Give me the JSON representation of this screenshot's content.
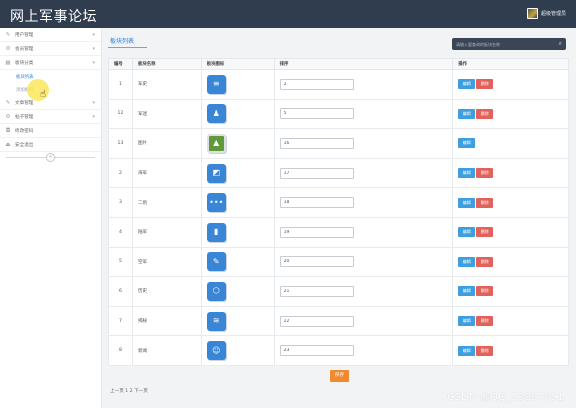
{
  "header": {
    "title": "网上军事论坛",
    "user_label": "超级管理员"
  },
  "sidebar": {
    "items": [
      {
        "label": "用户管理",
        "icon": "pencil-icon",
        "caret": "▾"
      },
      {
        "label": "会员管理",
        "icon": "gear-icon",
        "caret": "▾"
      },
      {
        "label": "板块分类",
        "icon": "calendar-icon",
        "caret": "▾",
        "children": [
          {
            "label": "板块列表"
          },
          {
            "label": "添加板块"
          }
        ]
      },
      {
        "label": "文章管理",
        "icon": "pencil-icon",
        "caret": "▾"
      },
      {
        "label": "帖子管理",
        "icon": "gear-icon",
        "caret": "▾"
      },
      {
        "label": "修改密码",
        "icon": "lock-icon"
      },
      {
        "label": "安全退出",
        "icon": "exit-icon"
      }
    ],
    "collapse_symbol": "«"
  },
  "main": {
    "tab_label": "板块列表",
    "search_placeholder": "请输入要查询的板块名称",
    "columns": [
      "编号",
      "板块名称",
      "板块图标",
      "排序",
      "操作"
    ],
    "rows": [
      {
        "id": "1",
        "name": "军史",
        "icon": "document-icon",
        "glyph": "≡",
        "order": "2"
      },
      {
        "id": "12",
        "name": "军迷",
        "icon": "qq-icon",
        "glyph": "♟",
        "order": "5"
      },
      {
        "id": "13",
        "name": "图片",
        "icon": "photo-icon",
        "glyph": "▲",
        "order": "16"
      },
      {
        "id": "2",
        "name": "海军",
        "icon": "image-icon",
        "glyph": "◩",
        "order": "17"
      },
      {
        "id": "3",
        "name": "二炮",
        "icon": "more-icon",
        "glyph": "•••",
        "order": "18"
      },
      {
        "id": "4",
        "name": "陆军",
        "icon": "info-icon",
        "glyph": "▮",
        "order": "19"
      },
      {
        "id": "5",
        "name": "空军",
        "icon": "edit-icon",
        "glyph": "✎",
        "order": "20"
      },
      {
        "id": "6",
        "name": "历史",
        "icon": "cube-icon",
        "glyph": "⬡",
        "order": "21"
      },
      {
        "id": "7",
        "name": "揭秘",
        "icon": "waves-icon",
        "glyph": "≋",
        "order": "22"
      },
      {
        "id": "8",
        "name": "新闻",
        "icon": "robot-icon",
        "glyph": "☺",
        "order": "23"
      }
    ],
    "edit_label": "编辑",
    "delete_label": "删除",
    "save_label": "保存",
    "pagination": "上一页 1 2 下一页"
  },
  "watermark": "CSDN @QQ_53887691",
  "colors": {
    "header_bg": "#2f3d4f",
    "primary": "#3d9fe0",
    "danger": "#e2625b",
    "accent": "#f08a2e"
  }
}
